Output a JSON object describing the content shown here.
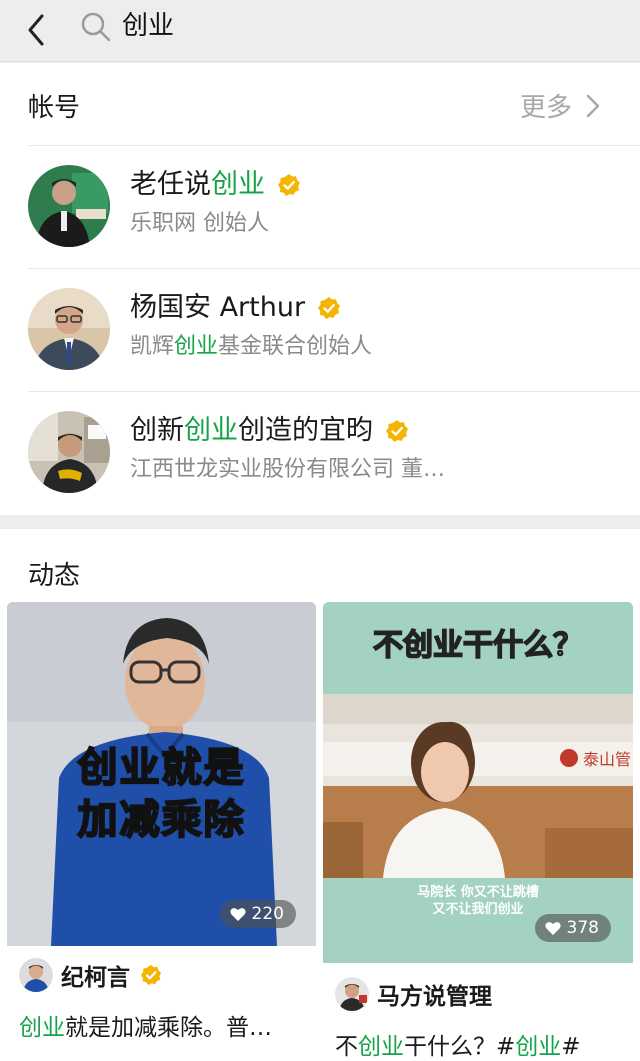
{
  "search": {
    "query": "创业"
  },
  "accounts_section": {
    "title": "帐号",
    "more_label": "更多",
    "items": [
      {
        "name_pre": "老任说",
        "name_hl": "创业",
        "name_post": "",
        "desc_pre": "乐职网 创始人",
        "desc_hl": "",
        "desc_post": ""
      },
      {
        "name_pre": "杨国安 Arthur",
        "name_hl": "",
        "name_post": "",
        "desc_pre": "凯辉",
        "desc_hl": "创业",
        "desc_post": "基金联合创始人"
      },
      {
        "name_pre": "创新",
        "name_hl": "创业",
        "name_post": "创造的宜昀",
        "desc_pre": "江西世龙实业股份有限公司 董…",
        "desc_hl": "",
        "desc_post": ""
      }
    ]
  },
  "feed_section": {
    "title": "动态",
    "cards": [
      {
        "video_caption_line1": "创业就是",
        "video_caption_line2": "加减乘除",
        "likes": "220",
        "author": "纪柯言",
        "verified": true,
        "caption_hl": "创业",
        "caption_rest": "就是加减乘除。普…"
      },
      {
        "video_top_caption": "不创业干什么？",
        "sign_text": "泰山管",
        "subtitle_line1": "马院长 你又不让跳槽",
        "subtitle_line2": "又不让我们创业",
        "likes": "378",
        "author": "马方说管理",
        "verified": false,
        "caption_pre": "不",
        "caption_hl": "创业",
        "caption_mid": "干什么？#",
        "caption_hl2": "创业",
        "caption_post": "#"
      }
    ]
  },
  "colors": {
    "accent_green": "#16a34a",
    "verified_gold": "#f5b400",
    "background": "#ededed"
  }
}
